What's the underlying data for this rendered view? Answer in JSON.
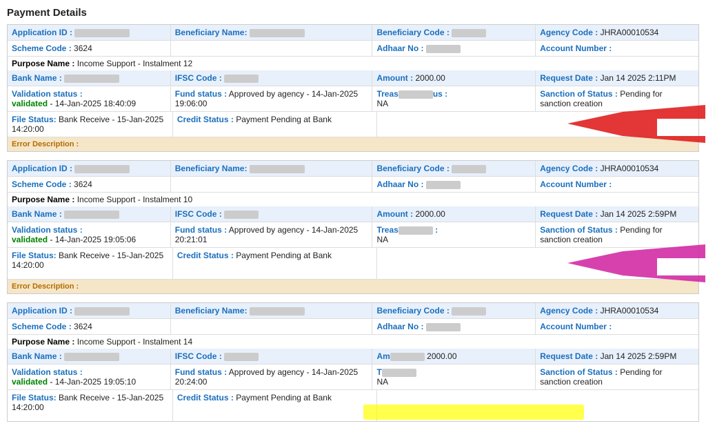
{
  "page": {
    "title": "Payment Details"
  },
  "cards": [
    {
      "id": 1,
      "application_id_label": "Application ID :",
      "application_id_value": "JI••••••••",
      "beneficiary_name_label": "Beneficiary Name:",
      "beneficiary_name_value": "••••••••",
      "beneficiary_code_label": "Beneficiary Code :",
      "beneficiary_code_value": "••••••",
      "agency_code_label": "Agency Code :",
      "agency_code_value": "JHRA00010534",
      "scheme_code_label": "Scheme Code :",
      "scheme_code_value": "3624",
      "adhaar_no_label": "Adhaar No :",
      "adhaar_no_value": "••••••••",
      "account_number_label": "Account Number :",
      "account_number_value": "",
      "purpose_label": "Purpose Name :",
      "purpose_value": "Income Support - Instalment 12",
      "bank_name_label": "Bank Name :",
      "bank_name_value": "",
      "ifsc_code_label": "IFSC Code :",
      "ifsc_code_value": "",
      "amount_label": "Amount :",
      "amount_value": "2000.00",
      "request_date_label": "Request Date :",
      "request_date_value": "Jan 14 2025 2:11PM",
      "validation_status_label": "Validation status :",
      "validation_status_value": "validated",
      "validation_date": "14-Jan-2025 18:40:09",
      "fund_status_label": "Fund status :",
      "fund_status_value": "Approved by agency - 14-Jan-2025 19:06:00",
      "treasury_label": "Treas••••us :",
      "treasury_value": "NA",
      "sanction_label": "Sanction of Status :",
      "sanction_value": "Pending for sanction creation",
      "file_status_label": "File Status:",
      "file_status_value": "Bank Receive - 15-Jan-2025 14:20:00",
      "credit_status_label": "Credit Status :",
      "credit_status_value": "Payment Pending at Bank",
      "error_desc_label": "Error Description :"
    },
    {
      "id": 2,
      "application_id_label": "Application ID :",
      "application_id_value": "JI••••••••",
      "beneficiary_name_label": "Beneficiary Name:",
      "beneficiary_name_value": "••••••••",
      "beneficiary_code_label": "Beneficiary Code :",
      "beneficiary_code_value": "••••••",
      "agency_code_label": "Agency Code :",
      "agency_code_value": "JHRA00010534",
      "scheme_code_label": "Scheme Code :",
      "scheme_code_value": "3624",
      "adhaar_no_label": "Adhaar No :",
      "adhaar_no_value": "••••••••",
      "account_number_label": "Account Number :",
      "account_number_value": "",
      "purpose_label": "Purpose Name :",
      "purpose_value": "Income Support - Instalment 10",
      "bank_name_label": "Bank Name :",
      "bank_name_value": "",
      "ifsc_code_label": "IFSC Code :",
      "ifsc_code_value": "",
      "amount_label": "Amount :",
      "amount_value": "2000.00",
      "request_date_label": "Request Date :",
      "request_date_value": "Jan 14 2025 2:59PM",
      "validation_status_label": "Validation status :",
      "validation_status_value": "validated",
      "validation_date": "14-Jan-2025 19:05:06",
      "fund_status_label": "Fund status :",
      "fund_status_value": "Approved by agency - 14-Jan-2025 20:21:01",
      "treasury_label": "Treas••••",
      "treasury_value": "NA",
      "sanction_label": "Sanction of Status :",
      "sanction_value": "Pending for sanction creation",
      "file_status_label": "File Status:",
      "file_status_value": "Bank Receive - 15-Jan-2025 14:20:00",
      "credit_status_label": "Credit Status :",
      "credit_status_value": "Payment Pending at Bank",
      "error_desc_label": "Error Description :"
    },
    {
      "id": 3,
      "application_id_label": "Application ID :",
      "application_id_value": "••••••••",
      "beneficiary_name_label": "Beneficiary Name:",
      "beneficiary_name_value": "••••••••",
      "beneficiary_code_label": "Beneficiary Code :",
      "beneficiary_code_value": "••••••",
      "agency_code_label": "Agency Code :",
      "agency_code_value": "JHRA00010534",
      "scheme_code_label": "Scheme Code :",
      "scheme_code_value": "3624",
      "adhaar_no_label": "Adhaar No :",
      "adhaar_no_value": "••••••••",
      "account_number_label": "Account Number :",
      "account_number_value": "",
      "purpose_label": "Purpose Name :",
      "purpose_value": "Income Support - Instalment 14",
      "bank_name_label": "Bank Name :",
      "bank_name_value": "",
      "ifsc_code_label": "IFSC Code :",
      "ifsc_code_value": "",
      "amount_label": "Am••••",
      "amount_value": "2000.00",
      "request_date_label": "Request Date :",
      "request_date_value": "Jan 14 2025 2:59PM",
      "validation_status_label": "Validation status :",
      "validation_status_value": "validated",
      "validation_date": "14-Jan-2025 19:05:10",
      "fund_status_label": "Fund status :",
      "fund_status_value": "Approved by agency - 14-Jan-2025 20:24:00",
      "treasury_label": "T•",
      "treasury_value": "NA",
      "sanction_label": "Sanction of Status :",
      "sanction_value": "Pending for sanction creation",
      "file_status_label": "File Status:",
      "file_status_value": "Bank Receive - 15-Jan-2025 14:20:00",
      "credit_status_label": "Credit Status :",
      "credit_status_value": "Payment Pending at Bank",
      "error_desc_label": ""
    }
  ]
}
